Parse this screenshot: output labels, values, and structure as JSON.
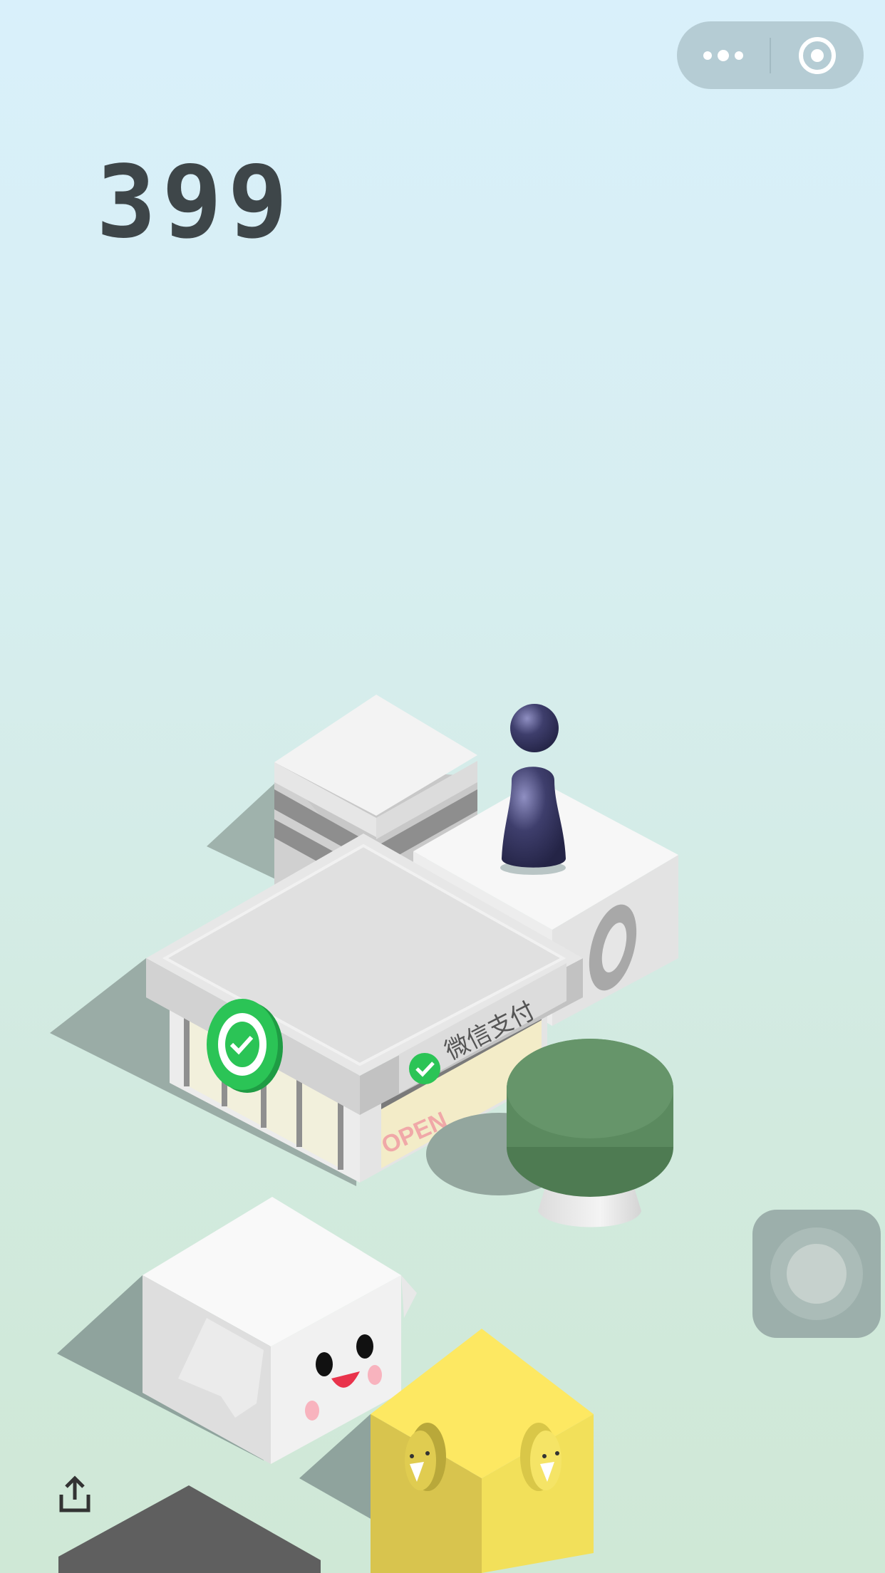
{
  "game": {
    "score": "399",
    "store_sign": "微信支付",
    "door_sign": "OPEN"
  },
  "capsule": {
    "more_icon": "more-dots-icon",
    "close_icon": "target-close-icon"
  },
  "controls": {
    "share_icon": "share-icon",
    "press_icon": "press-button-icon"
  },
  "colors": {
    "background_top": "#d9f0fb",
    "background_bottom": "#cfe8d6",
    "score_text": "#3e4649",
    "player": "#34345c",
    "wechat_green": "#2bc456",
    "table_top": "#66956a",
    "yellow_cube": "#fde862"
  }
}
